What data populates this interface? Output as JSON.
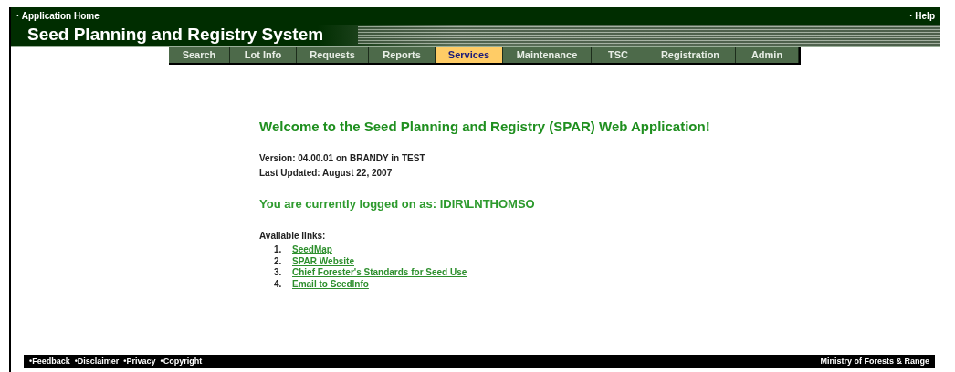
{
  "top_bar": {
    "home_link": "· Application Home",
    "help_link": "· Help"
  },
  "title": "Seed Planning and Registry System",
  "tabs": [
    {
      "label": "Search",
      "selected": false
    },
    {
      "label": "Lot Info",
      "selected": false
    },
    {
      "label": "Requests",
      "selected": false
    },
    {
      "label": "Reports",
      "selected": false
    },
    {
      "label": "Services",
      "selected": true
    },
    {
      "label": "Maintenance",
      "selected": false
    },
    {
      "label": "TSC",
      "selected": false
    },
    {
      "label": "Registration",
      "selected": false
    },
    {
      "label": "Admin",
      "selected": false
    }
  ],
  "welcome": "Welcome to the Seed Planning and Registry (SPAR) Web Application!",
  "version": "Version: 04.00.01 on BRANDY in TEST",
  "last_updated": "Last Updated: August 22, 2007",
  "logged_on": "You are currently logged on as: IDIR\\LNTHOMSO",
  "links_heading": "Available links:",
  "links": [
    {
      "number": "1.",
      "label": "SeedMap"
    },
    {
      "number": "2.",
      "label": "SPAR Website"
    },
    {
      "number": "3.",
      "label": "Chief Forester's Standards for Seed Use"
    },
    {
      "number": "4.",
      "label": "Email to SeedInfo"
    }
  ],
  "footer": {
    "links": [
      "•Feedback",
      "•Disclaimer",
      "•Privacy",
      "•Copyright"
    ],
    "ministry": "Ministry of Forests & Range"
  }
}
